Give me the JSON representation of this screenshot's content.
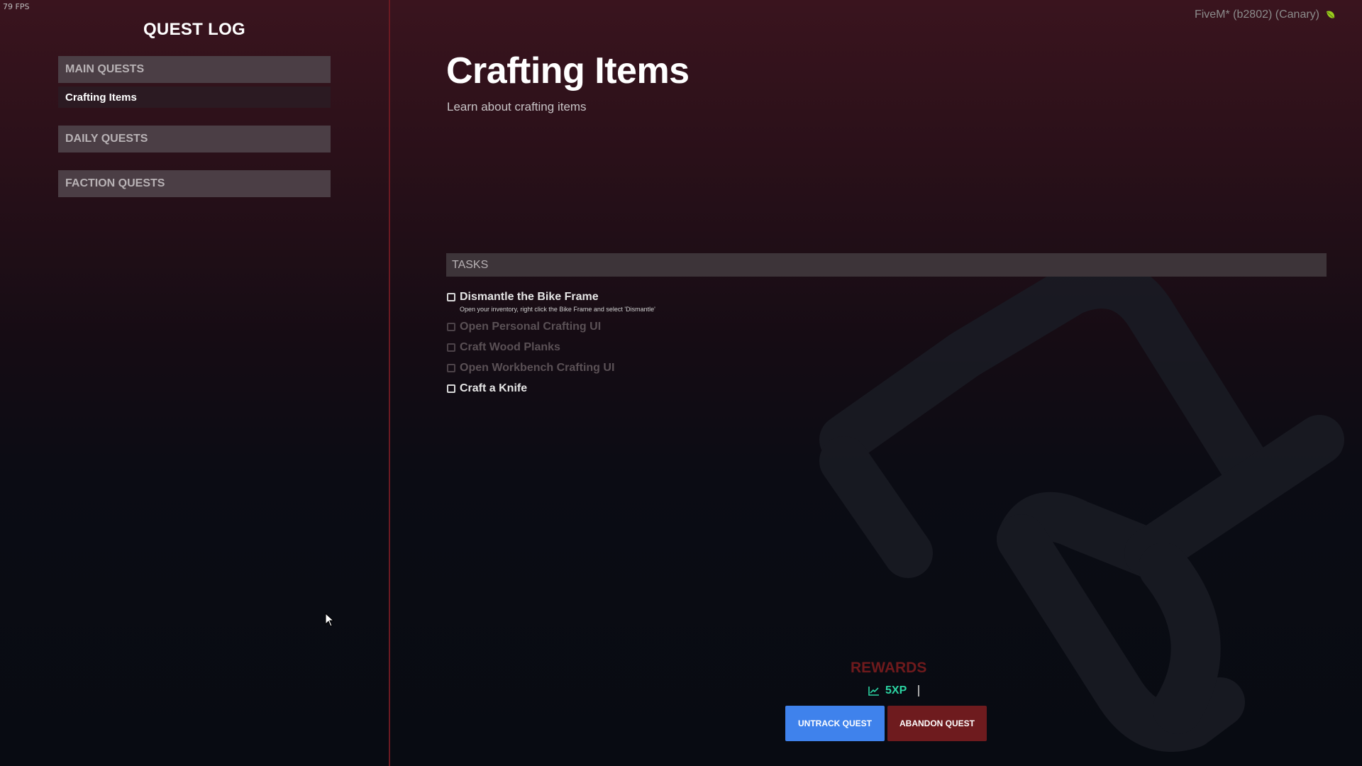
{
  "overlay": {
    "fps": "79 FPS",
    "build": "FiveM* (b2802) (Canary)",
    "build_icon": "leaf-icon"
  },
  "sidebar": {
    "title": "QUEST LOG",
    "categories": [
      {
        "label": "MAIN QUESTS",
        "items": [
          "Crafting Items"
        ]
      },
      {
        "label": "DAILY QUESTS",
        "items": []
      },
      {
        "label": "FACTION QUESTS",
        "items": []
      }
    ]
  },
  "quest": {
    "title": "Crafting Items",
    "description": "Learn about crafting items",
    "tasks_header": "TASKS",
    "tasks": [
      {
        "name": "Dismantle the Bike Frame",
        "detail": "Open your inventory, right click the Bike Frame and select 'Dismantle'",
        "active": true,
        "done": false
      },
      {
        "name": "Open Personal Crafting UI",
        "active": false,
        "done": false
      },
      {
        "name": "Craft Wood Planks",
        "active": false,
        "done": false
      },
      {
        "name": "Open Workbench Crafting UI",
        "active": false,
        "done": false
      },
      {
        "name": "Craft a Knife",
        "active": true,
        "done": false
      }
    ]
  },
  "rewards": {
    "title": "REWARDS",
    "xp": "5XP",
    "xp_icon": "chart-line-icon"
  },
  "actions": {
    "untrack": "UNTRACK QUEST",
    "abandon": "ABANDON QUEST"
  },
  "colors": {
    "accent_blue": "#3f82ec",
    "accent_red": "#6e1b1e",
    "xp_green": "#2bd3a1",
    "rewards_title": "#6f1a1c"
  }
}
